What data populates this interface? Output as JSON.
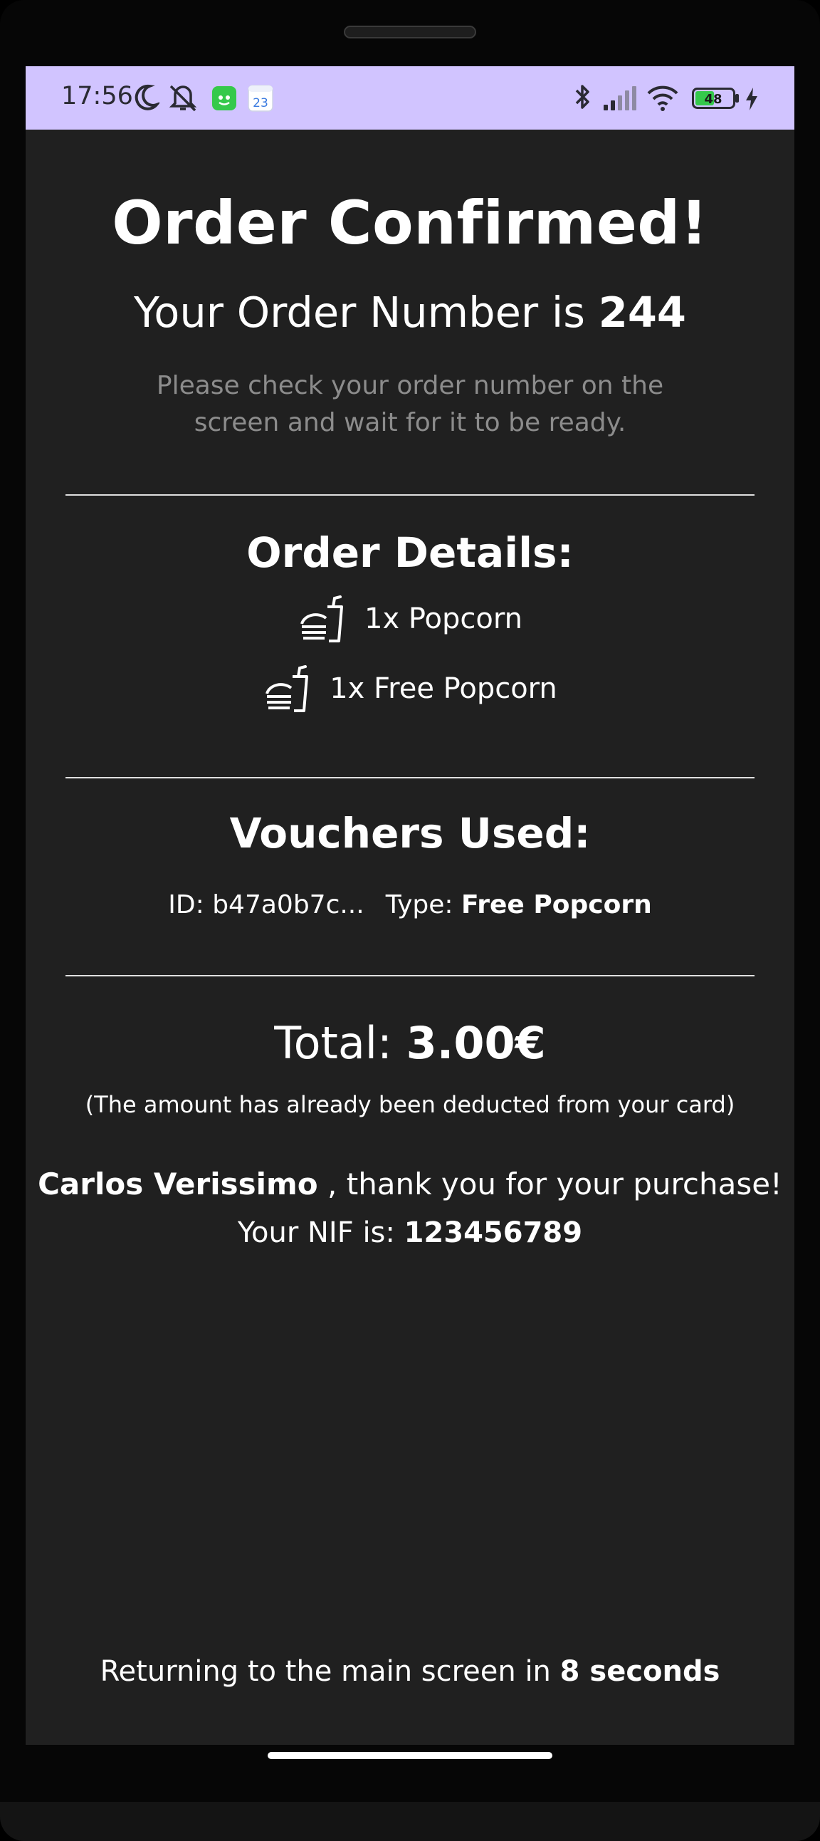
{
  "status_bar": {
    "time": "17:56",
    "battery_level": "48",
    "icons": [
      "moon-icon",
      "mute-icon",
      "app-icon",
      "calendar-icon",
      "bluetooth-icon",
      "signal-icon",
      "wifi-icon",
      "battery-icon",
      "charging-icon"
    ],
    "calendar_day": "23"
  },
  "header": {
    "title": "Order Confirmed!",
    "order_prefix": "Your Order Number is ",
    "order_number": "244",
    "instruction": "Please check your order number on the screen and wait for it to be ready."
  },
  "order_details": {
    "title": "Order Details:",
    "items": [
      {
        "label": "1x Popcorn",
        "icon": "popcorn-icon"
      },
      {
        "label": "1x Free Popcorn",
        "icon": "popcorn-icon"
      }
    ]
  },
  "vouchers": {
    "title": "Vouchers Used:",
    "id_label": "ID: b47a0b7c...",
    "type_label": "Type: ",
    "type_value": "Free Popcorn"
  },
  "total": {
    "label": "Total: ",
    "amount": "3.00€",
    "note": "(The amount has already been deducted from your card)"
  },
  "customer": {
    "name": "Carlos Verissimo",
    "thanks": " , thank you for your purchase!",
    "nif_label": "Your NIF is: ",
    "nif_value": "123456789"
  },
  "footer": {
    "returning_prefix": "Returning to the main screen in ",
    "returning_time": "8 seconds"
  },
  "colors": {
    "background": "#202020",
    "status_bar": "#d1c4ff",
    "muted_text": "#8c8c8c"
  }
}
